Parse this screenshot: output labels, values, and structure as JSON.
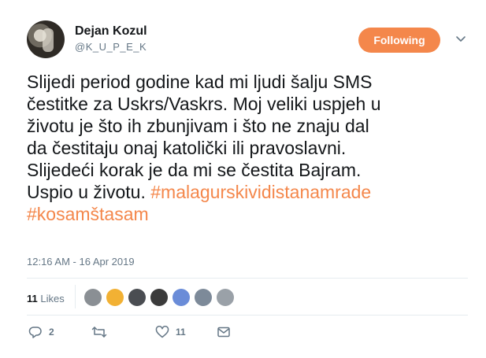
{
  "user": {
    "name": "Dejan Kozul",
    "handle": "@K_U_P_E_K"
  },
  "follow_button": {
    "label": "Following",
    "color": "#f4874b"
  },
  "tweet": {
    "lines": [
      [
        {
          "text": "Slijedi period godine kad mi ljudi šalju SMS"
        }
      ],
      [
        {
          "text": "čestitke za Uskrs/Vaskrs. Moj veliki uspjeh u"
        }
      ],
      [
        {
          "text": "životu je što ih zbunjivam i što ne znaju dal"
        }
      ],
      [
        {
          "text": "da čestitaju onaj katolički ili pravoslavni."
        }
      ],
      [
        {
          "text": "Slijedeći korak je da mi se čestita Bajram."
        }
      ],
      [
        {
          "text": "Uspio u životu. "
        },
        {
          "hashtag": "#malagurskividistanamrade"
        }
      ],
      [
        {
          "hashtag": "#kosamštasam"
        }
      ]
    ],
    "timestamp": "12:16 AM - 16 Apr 2019"
  },
  "likes": {
    "count": "11",
    "label": "Likes",
    "liker_avatars": [
      {
        "name": "liker-1",
        "color": "#8a8f94"
      },
      {
        "name": "liker-2",
        "color": "#f2b134"
      },
      {
        "name": "liker-3",
        "color": "#4a4d52"
      },
      {
        "name": "liker-4",
        "color": "#3b3b3b"
      },
      {
        "name": "liker-5",
        "color": "#6a8cd8"
      },
      {
        "name": "liker-6",
        "color": "#7d8a99"
      },
      {
        "name": "liker-7",
        "color": "#9aa1a8"
      }
    ]
  },
  "actions": {
    "reply_count": "2",
    "retweet_count": "",
    "like_count": "11"
  },
  "colors": {
    "accent": "#f4874b",
    "text": "#14171a",
    "muted": "#657786"
  }
}
